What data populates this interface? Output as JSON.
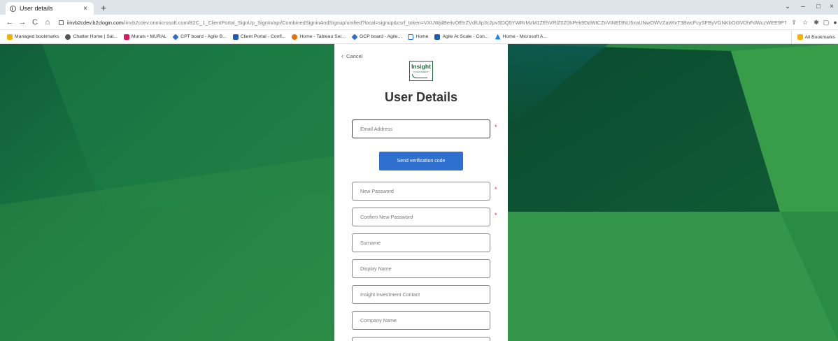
{
  "browser": {
    "tab_title": "User details",
    "tab_close": "×",
    "new_tab": "+",
    "url_host": "iinvb2cdev.b2clogin.com",
    "url_path": "/iinvb2cdev.onmicrosoft.com/B2C_1_ClientPortal_SignUp_SignIn/api/CombinedSigninAndSignup/unified?local=signup&csrf_token=VXUWjdBeitvOEtrZVdlUlp3c2pvSDQ5YWRrMzM1ZEhVRlZ0Z0hPek9DdWtCZnVtNEl3NU5xaUNwOWVZaWtvT3BwcFcySFByVGNKbOt3VDhFdWczWEE9PTs...",
    "window_controls": [
      "⌄",
      "–",
      "□",
      "×"
    ],
    "nav": {
      "back": "←",
      "forward": "→",
      "reload": "C",
      "home": "⌂"
    }
  },
  "bookmarks": {
    "items": [
      {
        "label": "Managed bookmarks",
        "color": "#f2b400"
      },
      {
        "label": "Chatter Home | Sal...",
        "color": "#555555"
      },
      {
        "label": "Murals • MURAL",
        "color": "#d81b60"
      },
      {
        "label": "CPT board - Agile B...",
        "color": "#2f6dd0"
      },
      {
        "label": "Client Portal - Confl...",
        "color": "#1c5bb8"
      },
      {
        "label": "Home - Tableau Ser...",
        "color": "#e8710a"
      },
      {
        "label": "GCP board - Agile...",
        "color": "#2f6dd0"
      },
      {
        "label": "Home",
        "color": "#1a73e8"
      },
      {
        "label": "Agile At Scale - Con...",
        "color": "#1c5bb8"
      },
      {
        "label": "Home - Microsoft A...",
        "color": "#1e88e5"
      }
    ],
    "all_label": "All Bookmarks",
    "all_color": "#f2b400"
  },
  "page": {
    "cancel_label": "Cancel",
    "logo_word": "Insight",
    "logo_sub": "INVESTMENT",
    "title": "User Details",
    "required_mark": "*",
    "fields": {
      "email_placeholder": "Email Address",
      "new_password_placeholder": "New Password",
      "confirm_password_placeholder": "Confirm New Password",
      "surname_placeholder": "Surname",
      "display_name_placeholder": "Display Name",
      "contact_placeholder": "Insight Investment Contact",
      "company_placeholder": "Company Name",
      "extra_placeholder": ""
    },
    "verify_button_label": "Send verification code",
    "colors": {
      "button_blue": "#2e6fcf",
      "brand_green": "#1d6a3a",
      "required_red": "#d32f2f"
    }
  }
}
